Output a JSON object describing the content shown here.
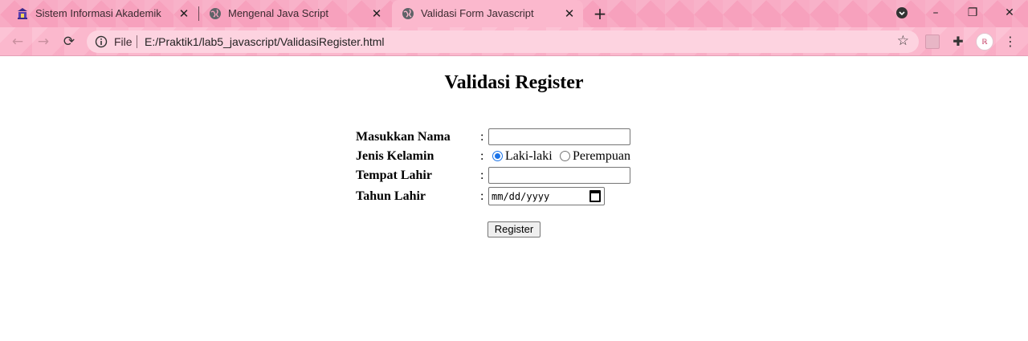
{
  "browser": {
    "tabs": [
      {
        "title": "Sistem Informasi Akademik",
        "favicon": "university-icon",
        "active": false
      },
      {
        "title": "Mengenal Java Script",
        "favicon": "globe-icon",
        "active": false
      },
      {
        "title": "Validasi Form Javascript",
        "favicon": "globe-icon",
        "active": true
      }
    ],
    "new_tab_symbol": "+",
    "window_controls": {
      "minimize": "–",
      "restore": "❐",
      "close": "✕"
    },
    "address": {
      "scheme_label": "File",
      "url": "E:/Praktik1/lab5_javascript/ValidasiRegister.html"
    },
    "profile_text": "ℝ",
    "accent_color": "#f7a1bd"
  },
  "page": {
    "title": "Validasi Register",
    "form": {
      "name_label": "Masukkan Nama",
      "gender_label": "Jenis Kelamin",
      "gender_options": [
        "Laki-laki",
        "Perempuan"
      ],
      "gender_selected": "Laki-laki",
      "birthplace_label": "Tempat Lahir",
      "birthyear_label": "Tahun Lahir",
      "date_placeholder": "mm/dd/yyyy",
      "colon": ":",
      "submit_label": "Register"
    }
  }
}
